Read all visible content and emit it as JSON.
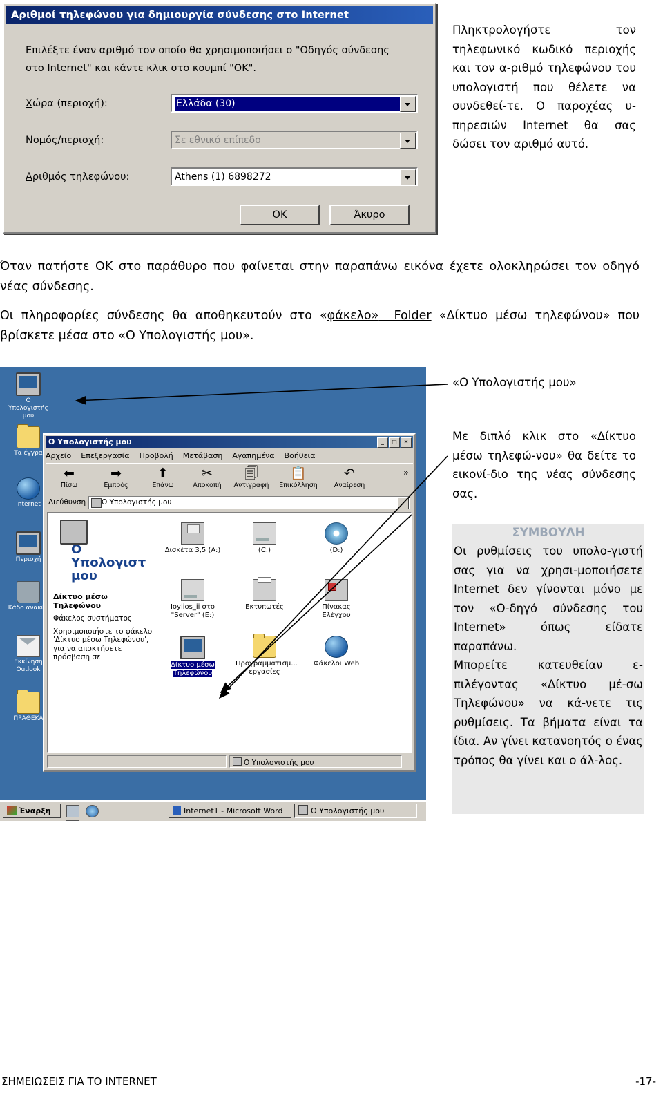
{
  "dialog": {
    "title": "Αριθμοί τηλεφώνου για δημιουργία σύνδεσης στο Internet",
    "instruction": "Επιλέξτε έναν αριθμό τον οποίο θα χρησιμοποιήσει ο \"Οδηγός σύνδεσης στο Internet\" και κάντε κλικ στο κουμπί \"ΟΚ\".",
    "fields": [
      {
        "label": "Χώρα (περιοχή):",
        "value": "Ελλάδα (30)",
        "state": "selected"
      },
      {
        "label": "Νομός/περιοχή:",
        "value": "Σε εθνικό επίπεδο",
        "state": "disabled"
      },
      {
        "label": "Αριθμός τηλεφώνου:",
        "value": "Athens (1) 6898272",
        "state": "normal"
      }
    ],
    "buttons": {
      "ok": "OK",
      "cancel": "Άκυρο"
    }
  },
  "sidenote_top": "Πληκτρολογήστε τον τηλεφωνικό κωδικό περιοχής και τον α-ριθμό τηλεφώνου του υπολογιστή που θέλετε να συνδεθεί-τε. Ο παροχέας υ-πηρεσιών Internet θα σας δώσει τον αριθμό αυτό.",
  "paragraphs": {
    "p1": "Όταν πατήστε ΟΚ στο παράθυρο που φαίνεται στην παραπάνω εικόνα έχετε ολοκληρώσει τον οδηγό νέας σύνδεσης.",
    "p2_pre": "Οι πληροφορίες σύνδεσης θα αποθηκευτούν στο «",
    "p2_u1": "φάκελο»",
    "p2_u2": "Folder",
    "p2_post": " «Δίκτυο μέσω τηλεφώνου» που βρίσκετε μέσα στο «Ο Υπολογιστής μου»."
  },
  "callouts": {
    "mycomputer": "«Ο Υπολογιστής μου»",
    "dblclick": "Με διπλό κλικ στο «Δίκτυο μέσω τηλεφώ-νου» θα δείτε το εικονί-διο της νέας σύνδεσης σας."
  },
  "tip": {
    "title": "ΣΥΜΒΟΥΛΗ",
    "p1": "Οι ρυθμίσεις του υπολο-γιστή σας για να χρησι-μοποιήσετε Internet δεν γίνονται μόνο με τον «Ο-δηγό σύνδεσης του Internet» όπως είδατε παραπάνω.",
    "p2": "Μπορείτε κατευθείαν ε-πιλέγοντας «Δίκτυο μέ-σω Τηλεφώνου» να κά-νετε τις ρυθμίσεις. Τα βήματα είναι τα ίδια. Αν γίνει κατανοητός ο ένας τρόπος θα γίνει και ο άλ-λος."
  },
  "desktop": {
    "icons": [
      {
        "label": "Ο Υπολογιστής μου",
        "icon": "my-computer-icon"
      },
      {
        "label": "Τα έγγρα",
        "icon": "folder-icon"
      },
      {
        "label": "Internet",
        "icon": "globe-icon"
      },
      {
        "label": "Περιοχή",
        "icon": "network-icon"
      },
      {
        "label": "Κάδο ανακύκ",
        "icon": "recycle-bin-icon"
      },
      {
        "label": "Εκκίνηση Outlook",
        "icon": "outlook-icon"
      },
      {
        "label": "ΠΡΑΘΕΚΑ",
        "icon": "folder-icon"
      }
    ]
  },
  "explorer": {
    "title": "Ο Υπολογιστής μου",
    "title_buttons": [
      "_",
      "□",
      "✕"
    ],
    "menu": [
      "Αρχείο",
      "Επεξεργασία",
      "Προβολή",
      "Μετάβαση",
      "Αγαπημένα",
      "Βοήθεια"
    ],
    "toolbar": [
      {
        "label": "Πίσω",
        "icon": "back-arrow-icon"
      },
      {
        "label": "Εμπρός",
        "icon": "forward-arrow-icon"
      },
      {
        "label": "Επάνω",
        "icon": "up-folder-icon"
      },
      {
        "label": "Αποκοπή",
        "icon": "scissors-icon"
      },
      {
        "label": "Αντιγραφή",
        "icon": "copy-icon"
      },
      {
        "label": "Επικόλληση",
        "icon": "paste-icon"
      },
      {
        "label": "Αναίρεση",
        "icon": "undo-icon"
      }
    ],
    "toolbar_overflow": "»",
    "address_label": "Διεύθυνση",
    "address_value": "Ο Υπολογιστής μου",
    "infopane": {
      "heading": "Ο Υπολογιστ μου",
      "sub": "Δίκτυο μέσω Τηλεφώνου",
      "desc1": "Φάκελος συστήματος",
      "desc2": "Χρησιμοποιήστε το φάκελο 'Δίκτυο μέσω Τηλεφώνου', για να αποκτήσετε πρόσβαση σε"
    },
    "items": [
      {
        "label": "Δισκέτα 3,5 (A:)",
        "icon": "floppy-icon",
        "selected": false
      },
      {
        "label": "(C:)",
        "icon": "harddrive-icon",
        "selected": false
      },
      {
        "label": "(D:)",
        "icon": "cdrom-icon",
        "selected": false
      },
      {
        "label": "Ioylios_ii στο \"Server\" (E:)",
        "icon": "network-drive-icon",
        "selected": false
      },
      {
        "label": "Εκτυπωτές",
        "icon": "printers-icon",
        "selected": false
      },
      {
        "label": "Πίνακας Ελέγχου",
        "icon": "control-panel-icon",
        "selected": false
      },
      {
        "label": "Δίκτυο μέσω Τηλεφώνου",
        "icon": "dialup-networking-icon",
        "selected": true
      },
      {
        "label": "Προγραμματισμ... εργασίες",
        "icon": "scheduled-tasks-icon",
        "selected": false
      },
      {
        "label": "Φάκελοι Web",
        "icon": "web-folders-icon",
        "selected": false
      }
    ],
    "status": "Ο Υπολογιστής μου"
  },
  "taskbar": {
    "start": "Έναρξη",
    "tray_icons": [
      "app-icon-1",
      "app-icon-2",
      "app-icon-3"
    ],
    "tasks": [
      {
        "label": "Internet1 - Microsoft Word",
        "active": false
      },
      {
        "label": "Ο Υπολογιστής μου",
        "active": true
      }
    ]
  },
  "footer": {
    "left": "ΣΗΜΕΙΩΣΕΙΣ ΓΙΑ ΤΟ INTERNET",
    "right": "-17-"
  },
  "colors": {
    "titlebar_start": "#0a246a",
    "titlebar_end": "#2a5fba",
    "window_face": "#d4d0c8",
    "desktop": "#3a6ea5",
    "selection": "#000080",
    "tip_bg": "#e8e8e8",
    "tip_title": "#9aa6b5"
  }
}
